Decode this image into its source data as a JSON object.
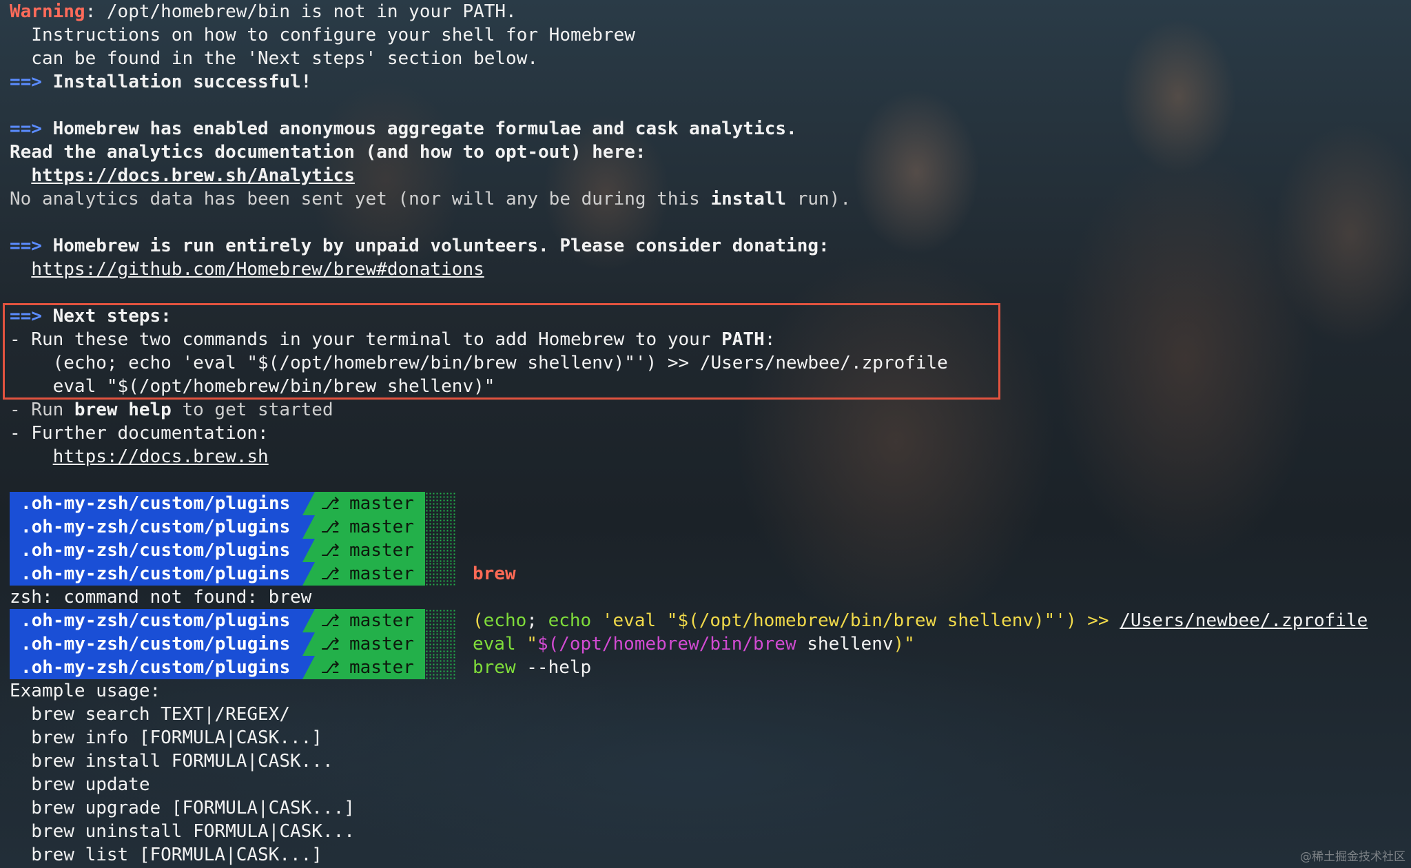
{
  "colors": {
    "warning": "#ff6b5a",
    "arrow": "#5b8cff",
    "path_segment": "#1a4fd6",
    "git_segment": "#23b04a",
    "highlight_box": "#e2533f",
    "cmd_yellow": "#f0d94a",
    "cmd_green": "#7fdc3a",
    "cmd_magenta": "#d24bd2",
    "cmd_red": "#ff6a55"
  },
  "output": {
    "warning_label": "Warning",
    "warning_text": ": /opt/homebrew/bin is not in your PATH.",
    "instr_line1": "  Instructions on how to configure your shell for Homebrew",
    "instr_line2": "  can be found in the 'Next steps' section below.",
    "arrow": "==>",
    "install_success": " Installation successful!",
    "analytics_enabled": " Homebrew has enabled anonymous aggregate formulae and cask analytics.",
    "analytics_read": "Read the analytics documentation (and how to opt-out) here:",
    "analytics_url": "https://docs.brew.sh/Analytics",
    "no_data_prefix": "No analytics data has been sent yet (nor will any be during this ",
    "no_data_install": "install",
    "no_data_suffix": " run).",
    "volunteers": " Homebrew is run entirely by unpaid volunteers. Please consider donating:",
    "donations_url": "https://github.com/Homebrew/brew#donations",
    "next_steps": " Next steps:",
    "run_commands_prefix": "- Run these two commands in your terminal to add Homebrew to your ",
    "run_commands_path": "PATH",
    "run_commands_suffix": ":",
    "cmd1": "    (echo; echo 'eval \"$(/opt/homebrew/bin/brew shellenv)\"') >> /Users/newbee/.zprofile",
    "cmd2": "    eval \"$(/opt/homebrew/bin/brew shellenv)\"",
    "run_help_prefix": "- Run ",
    "run_help_cmd": "brew help",
    "run_help_suffix": " to get started",
    "further_docs": "- Further documentation:",
    "docs_indent": "    ",
    "docs_url": "https://docs.brew.sh"
  },
  "prompt": {
    "path": ".oh-my-zsh/custom/plugins",
    "branch": "master",
    "branch_icon": "git-branch-icon"
  },
  "session": {
    "cmd_brew": "brew",
    "not_found": "zsh: command not found: brew",
    "cmd_echo_open": "(",
    "cmd_echo_1": "echo",
    "cmd_echo_sep": "; ",
    "cmd_echo_2": "echo",
    "cmd_echo_str": " 'eval \"$(/opt/homebrew/bin/brew shellenv)\"') >> ",
    "cmd_echo_file": "/Users/newbee/.zprofile",
    "cmd_eval_kw": "eval",
    "cmd_eval_q1": " \"",
    "cmd_eval_sub": "$(/opt/homebrew/bin/brew",
    "cmd_eval_arg": " shellenv",
    "cmd_eval_close": ")\"",
    "cmd_help_brew": "brew",
    "cmd_help_flag": " --help",
    "usage_title": "Example usage:",
    "usage_lines": [
      "  brew search TEXT|/REGEX/",
      "  brew info [FORMULA|CASK...]",
      "  brew install FORMULA|CASK...",
      "  brew update",
      "  brew upgrade [FORMULA|CASK...]",
      "  brew uninstall FORMULA|CASK...",
      "  brew list [FORMULA|CASK...]"
    ]
  },
  "watermark": "@稀土掘金技术社区"
}
